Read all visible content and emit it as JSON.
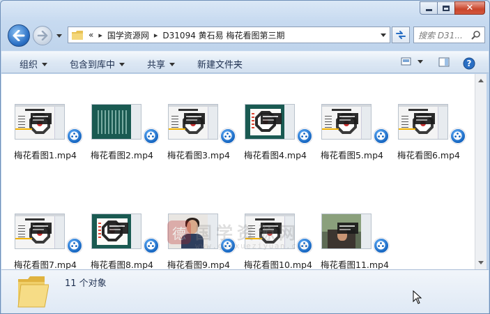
{
  "window": {
    "caption_buttons": [
      "minimize",
      "maximize",
      "close"
    ]
  },
  "breadcrumb": {
    "overflow": "«",
    "items": [
      "国学资源网",
      "D31094 黄石易  梅花看图第三期"
    ]
  },
  "search": {
    "placeholder": "搜索 D31..."
  },
  "toolbar": {
    "organize": "组织",
    "include_library": "包含到库中",
    "share": "共享",
    "new_folder": "新建文件夹"
  },
  "files": [
    {
      "name": "梅花看图1.mp4",
      "thumb": "light"
    },
    {
      "name": "梅花看图2.mp4",
      "thumb": "dark-grid"
    },
    {
      "name": "梅花看图3.mp4",
      "thumb": "light"
    },
    {
      "name": "梅花看图4.mp4",
      "thumb": "dark-panel"
    },
    {
      "name": "梅花看图5.mp4",
      "thumb": "light"
    },
    {
      "name": "梅花看图6.mp4",
      "thumb": "light"
    },
    {
      "name": "梅花看图7.mp4",
      "thumb": "light"
    },
    {
      "name": "梅花看图8.mp4",
      "thumb": "dark-panel"
    },
    {
      "name": "梅花看图9.mp4",
      "thumb": "person"
    },
    {
      "name": "梅花看图10.mp4",
      "thumb": "light"
    },
    {
      "name": "梅花看图11.mp4",
      "thumb": "photo"
    }
  ],
  "watermark": {
    "seal": "德",
    "text": "国学资源网",
    "url": "www.guoxueziyuan.com"
  },
  "details": {
    "count": "11 个对象"
  },
  "colors": {
    "accent": "#2a6fc4",
    "close_red": "#c9452b",
    "badge_blue": "#1565c0"
  }
}
